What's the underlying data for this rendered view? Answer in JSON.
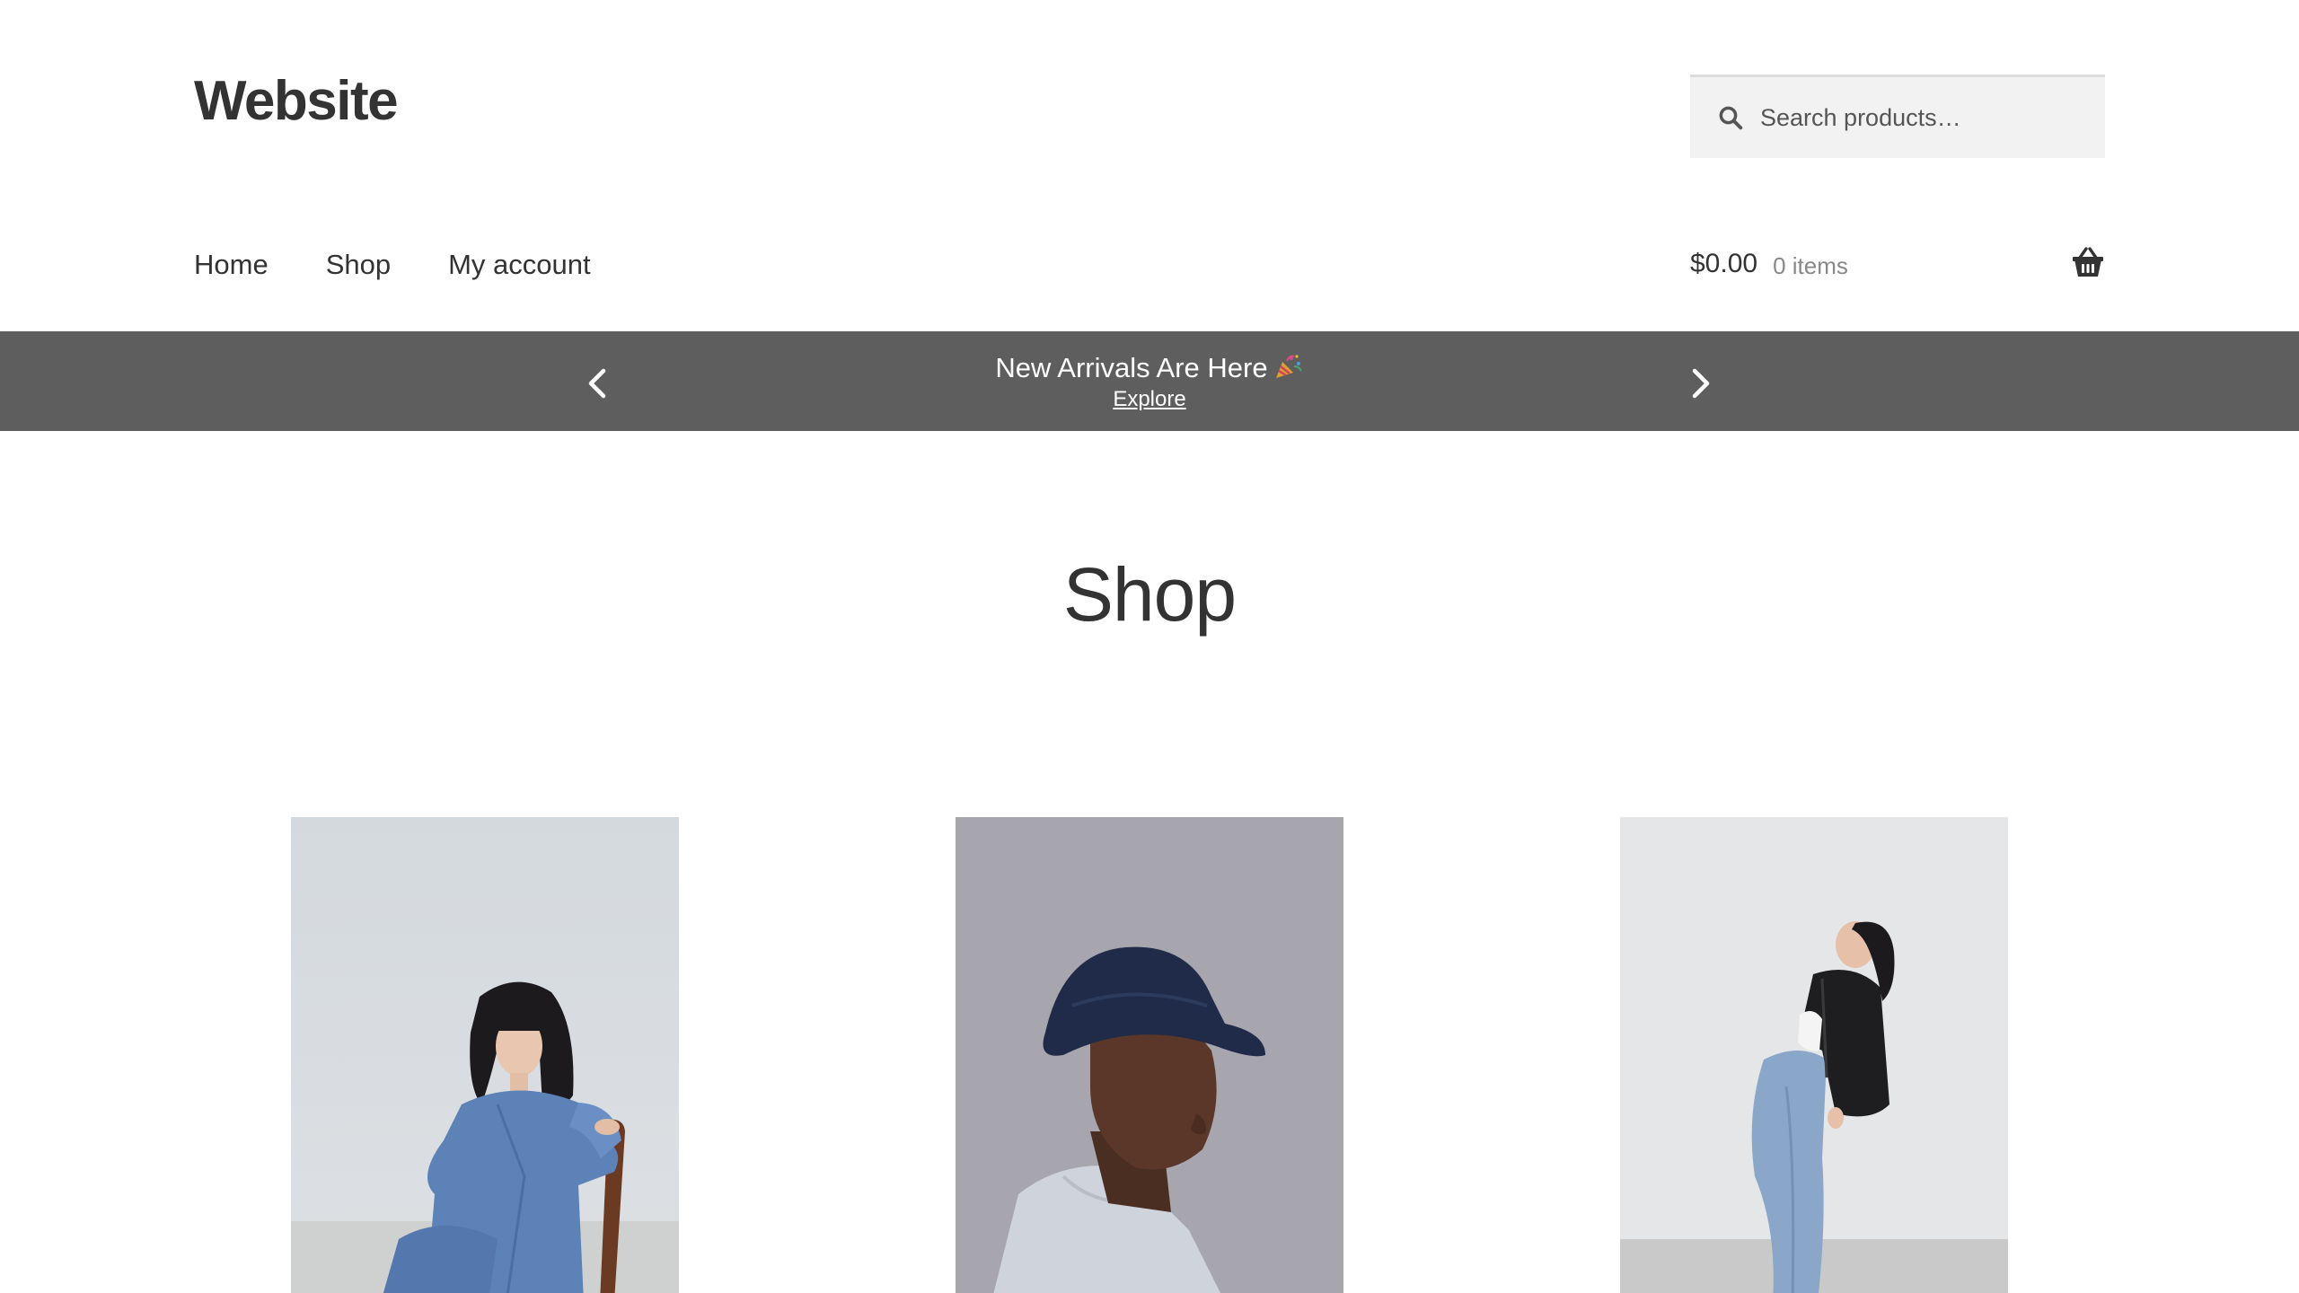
{
  "header": {
    "site_title": "Website",
    "search": {
      "placeholder": "Search products…",
      "icon": "search-icon"
    }
  },
  "nav": {
    "items": [
      {
        "label": "Home"
      },
      {
        "label": "Shop"
      },
      {
        "label": "My account"
      }
    ]
  },
  "cart": {
    "amount": "$0.00",
    "count": "0 items",
    "icon": "basket-icon"
  },
  "banner": {
    "headline": "New Arrivals Are Here",
    "emoji_icon": "party-popper-icon",
    "link_label": "Explore",
    "background": "#5e5e5e"
  },
  "main": {
    "title": "Shop",
    "products": [
      {
        "image": "woman-blue-outfit-chair-photo"
      },
      {
        "image": "man-bucket-hat-photo"
      },
      {
        "image": "woman-black-jacket-jeans-photo"
      }
    ]
  }
}
